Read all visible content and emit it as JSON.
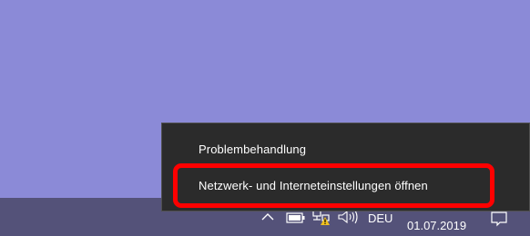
{
  "context_menu": {
    "items": [
      {
        "label": "Problembehandlung"
      },
      {
        "label": "Netzwerk- und Interneteinstellungen öffnen",
        "highlighted": true
      }
    ]
  },
  "taskbar": {
    "tray_icons": [
      "chevron-up-icon",
      "battery-icon",
      "network-warning-icon",
      "volume-icon"
    ],
    "language": "DEU",
    "date": "01.07.2019",
    "notification_icon": "action-center-icon"
  },
  "colors": {
    "desktop_background": "#8b8ad7",
    "taskbar_background": "#545279",
    "menu_background": "#2b2b2b",
    "highlight_border": "#ff0000",
    "warning_icon": "#f0c020"
  }
}
